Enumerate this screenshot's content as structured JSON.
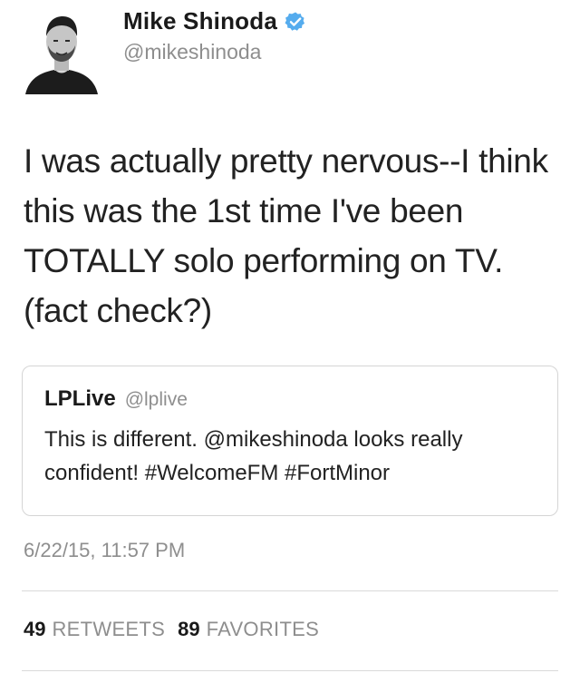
{
  "author": {
    "display_name": "Mike Shinoda",
    "handle": "@mikeshinoda",
    "verified": true,
    "avatar_icon": "user-avatar-photo"
  },
  "tweet": {
    "text": "I was actually pretty nervous--I think this was the 1st time I've been TOTALLY solo performing on TV. (fact check?)"
  },
  "quoted_tweet": {
    "display_name": "LPLive",
    "handle": "@lplive",
    "text": "This is different. @mikeshinoda looks really confident! #WelcomeFM #FortMinor"
  },
  "timestamp": "6/22/15, 11:57 PM",
  "stats": {
    "retweets_count": "49",
    "retweets_label": "RETWEETS",
    "favorites_count": "89",
    "favorites_label": "FAVORITES"
  },
  "colors": {
    "verified_badge": "#55acee",
    "secondary_text": "#8e8e8e",
    "border": "#d5d5d5"
  }
}
